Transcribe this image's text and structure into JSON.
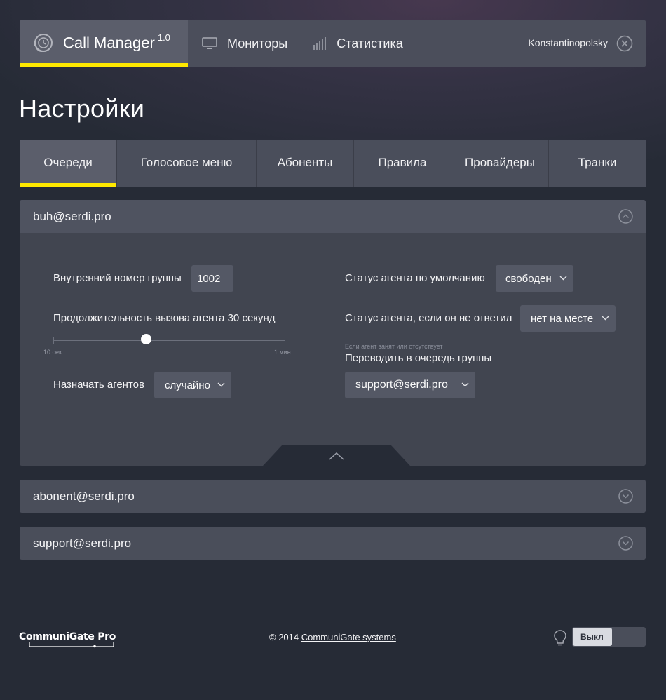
{
  "header": {
    "app_title": "Call Manager",
    "app_version": "1.0",
    "nav": [
      {
        "label": "Мониторы",
        "icon": "monitor-icon"
      },
      {
        "label": "Статистика",
        "icon": "bar-chart-icon"
      }
    ],
    "user_name": "Konstantinopolsky"
  },
  "page_title": "Настройки",
  "tabs": [
    {
      "label": "Очереди",
      "active": true
    },
    {
      "label": "Голосовое меню",
      "active": false
    },
    {
      "label": "Абоненты",
      "active": false
    },
    {
      "label": "Правила",
      "active": false
    },
    {
      "label": "Провайдеры",
      "active": false
    },
    {
      "label": "Транки",
      "active": false
    }
  ],
  "queues": [
    {
      "name": "buh@serdi.pro",
      "expanded": true,
      "settings": {
        "group_number_label": "Внутренний номер группы",
        "group_number_value": "1002",
        "call_duration_label": "Продолжительность вызова агента 30 секунд",
        "slider_min_label": "10 сек",
        "slider_max_label": "1 мин",
        "slider_value_seconds": 30,
        "assign_agents_label": "Назначать агентов",
        "assign_agents_value": "случайно",
        "default_status_label": "Статус агента по умолчанию",
        "default_status_value": "свободен",
        "noanswer_status_label": "Статус агента, если он не ответил",
        "noanswer_status_value": "нет на месте",
        "forward_note": "Если агент занят или отсутствует",
        "forward_label": "Переводить в очередь группы",
        "forward_value": "support@serdi.pro"
      }
    },
    {
      "name": "abonent@serdi.pro",
      "expanded": false
    },
    {
      "name": "support@serdi.pro",
      "expanded": false
    }
  ],
  "footer": {
    "logo_text": "CommuniGate Pro",
    "copyright_prefix": "© 2014",
    "copyright_link": "CommuniGate systems",
    "toggle_label": "Выкл"
  },
  "colors": {
    "accent": "#ffe900",
    "background": "#262b36",
    "panel": "#4a4e5a"
  }
}
